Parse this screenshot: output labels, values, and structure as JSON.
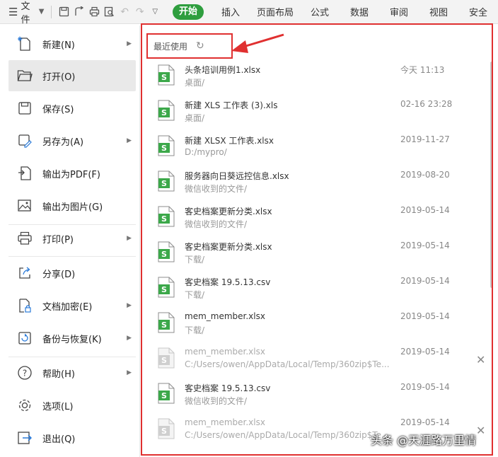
{
  "toolbar": {
    "file_label": "文件",
    "tabs": [
      "开始",
      "插入",
      "页面布局",
      "公式",
      "数据",
      "审阅",
      "视图",
      "安全"
    ]
  },
  "menu": {
    "items": [
      {
        "label": "新建(N)",
        "icon": "new-file-icon"
      },
      {
        "label": "打开(O)",
        "icon": "folder-open-icon"
      },
      {
        "label": "保存(S)",
        "icon": "save-icon"
      },
      {
        "label": "另存为(A)",
        "icon": "save-as-icon"
      },
      {
        "label": "输出为PDF(F)",
        "icon": "pdf-export-icon"
      },
      {
        "label": "输出为图片(G)",
        "icon": "image-export-icon"
      },
      {
        "label": "打印(P)",
        "icon": "printer-icon"
      },
      {
        "label": "分享(D)",
        "icon": "share-icon"
      },
      {
        "label": "文档加密(E)",
        "icon": "encrypt-icon"
      },
      {
        "label": "备份与恢复(K)",
        "icon": "backup-icon"
      },
      {
        "label": "帮助(H)",
        "icon": "help-icon"
      },
      {
        "label": "选项(L)",
        "icon": "gear-icon"
      },
      {
        "label": "退出(Q)",
        "icon": "exit-icon"
      }
    ]
  },
  "recent": {
    "title": "最近使用",
    "files": [
      {
        "name": "头条培训用例1.xlsx",
        "path": "桌面/",
        "time": "今天 11:13",
        "available": true
      },
      {
        "name": "新建 XLS 工作表 (3).xls",
        "path": "桌面/",
        "time": "02-16 23:28",
        "available": true
      },
      {
        "name": "新建 XLSX 工作表.xlsx",
        "path": "D:/mypro/",
        "time": "2019-11-27",
        "available": true
      },
      {
        "name": "服务器向日葵远控信息.xlsx",
        "path": "微信收到的文件/",
        "time": "2019-08-20",
        "available": true
      },
      {
        "name": "客史档案更新分类.xlsx",
        "path": "微信收到的文件/",
        "time": "2019-05-14",
        "available": true
      },
      {
        "name": "客史档案更新分类.xlsx",
        "path": "下载/",
        "time": "2019-05-14",
        "available": true
      },
      {
        "name": "客史档案 19.5.13.csv",
        "path": "下载/",
        "time": "2019-05-14",
        "available": true
      },
      {
        "name": "mem_member.xlsx",
        "path": "下载/",
        "time": "2019-05-14",
        "available": true
      },
      {
        "name": "mem_member.xlsx",
        "path": "C:/Users/owen/AppData/Local/Temp/360zip$Te...",
        "time": "2019-05-14",
        "available": false
      },
      {
        "name": "客史档案 19.5.13.csv",
        "path": "微信收到的文件/",
        "time": "2019-05-14",
        "available": true
      },
      {
        "name": "mem_member.xlsx",
        "path": "C:/Users/owen/AppData/Local/Temp/360zip$Te...",
        "time": "2019-05-14",
        "available": false
      }
    ]
  },
  "watermark": "头条 @天涯路万里情",
  "colors": {
    "accent": "#2e9e3e",
    "highlight": "#e03030"
  }
}
